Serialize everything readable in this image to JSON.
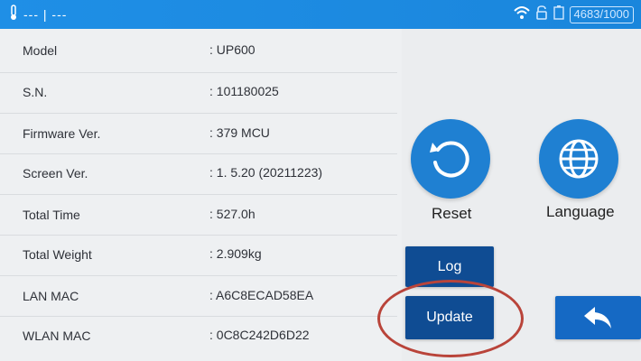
{
  "status_bar": {
    "placeholder_text": "--- | ---",
    "counter": "4683/1000",
    "icons": [
      "thermometer-icon",
      "wifi-icon",
      "lock-icon",
      "battery-icon"
    ]
  },
  "info": {
    "rows": [
      {
        "label": "Model",
        "value": ": UP600"
      },
      {
        "label": "S.N.",
        "value": ": 101180025"
      },
      {
        "label": "Firmware Ver.",
        "value": ": 379 MCU"
      },
      {
        "label": "Screen Ver.",
        "value": ": 1. 5.20 (20211223)"
      },
      {
        "label": "Total Time",
        "value": ": 527.0h"
      },
      {
        "label": "Total Weight",
        "value": ": 2.909kg"
      },
      {
        "label": "LAN MAC",
        "value": ": A6C8ECAD58EA"
      },
      {
        "label": "WLAN MAC",
        "value": ": 0C8C242D6D22"
      }
    ]
  },
  "actions": {
    "reset_label": "Reset",
    "language_label": "Language",
    "log_label": "Log",
    "update_label": "Update"
  },
  "colors": {
    "status_bar": "#1f8fe6",
    "circle_button": "#1f80d2",
    "rect_button": "#0f4c93",
    "highlight": "#b9443a"
  }
}
